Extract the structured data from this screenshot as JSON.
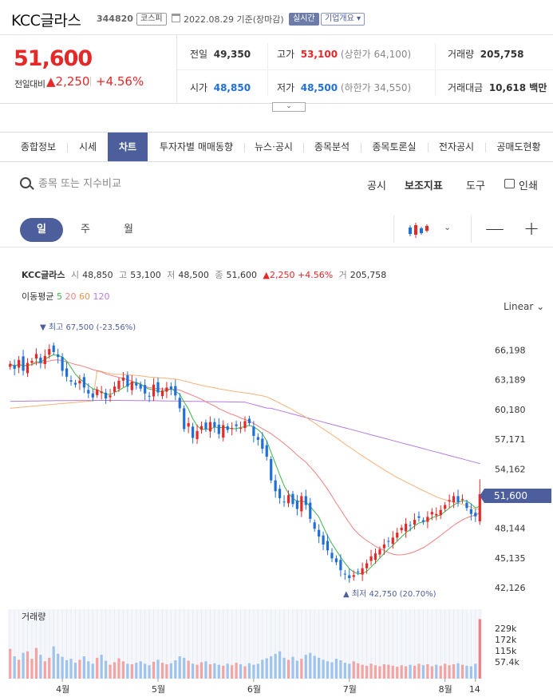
{
  "header": {
    "stock_name": "KCC글라스",
    "stock_code": "344820",
    "market_badge": "코스피",
    "date": "2022.08.29 기준(장마감)",
    "realtime_badge": "실시간",
    "company_badge": "기업개요 ▾"
  },
  "summary": {
    "current_price": "51,600",
    "change_label": "전일대비",
    "change_value": "▲2,250",
    "change_pct": "+4.56%",
    "prev_label": "전일",
    "prev_value": "49,350",
    "high_label": "고가",
    "high_value": "53,100",
    "upper_limit": "(상한가 64,100)",
    "volume_label": "거래량",
    "volume_value": "205,758",
    "open_label": "시가",
    "open_value": "48,850",
    "low_label": "저가",
    "low_value": "48,500",
    "lower_limit": "(하한가 34,550)",
    "amount_label": "거래대금",
    "amount_value": "10,618 백만",
    "toggle": "⌄"
  },
  "tabs": [
    {
      "label": "종합정보"
    },
    {
      "label": "시세"
    },
    {
      "label": "차트"
    },
    {
      "label": "투자자별 매매동향"
    },
    {
      "label": "뉴스·공시"
    },
    {
      "label": "종목분석"
    },
    {
      "label": "종목토론실"
    },
    {
      "label": "전자공시"
    },
    {
      "label": "공매도현황"
    }
  ],
  "toolbar": {
    "search_placeholder": "종목 또는 지수비교",
    "disclosure": "공시",
    "indicator": "보조지표",
    "tools": "도구",
    "print": "인쇄"
  },
  "period": {
    "day": "일",
    "week": "주",
    "month": "월",
    "zoom_out": "—",
    "zoom_in": "+"
  },
  "info": {
    "name": "KCC글라스",
    "open_l": "시",
    "open": "48,850",
    "high_l": "고",
    "high": "53,100",
    "low_l": "저",
    "low": "48,500",
    "close_l": "종",
    "close": "51,600",
    "chg": "▲2,250 +4.56%",
    "vol_l": "거",
    "vol": "205,758"
  },
  "ma": {
    "label": "이동평균",
    "ma5": "5",
    "ma20": "20",
    "ma60": "60",
    "ma120": "120"
  },
  "scale_mode": "Linear ⌄",
  "colors": {
    "up": "#e52828",
    "down": "#1f6fd6",
    "ma5": "#3cb44b",
    "ma20": "#f08080",
    "ma60": "#f5b27a",
    "ma120": "#b57be0",
    "accent": "#4c5f9c"
  },
  "chart_data": {
    "type": "candlestick",
    "y_ticks": [
      66198,
      63189,
      60180,
      57171,
      54162,
      48144,
      45135,
      42126
    ],
    "y_tick_labels": [
      "66,198",
      "63,189",
      "60,180",
      "57,171",
      "54,162",
      "48,144",
      "45,135",
      "42,126"
    ],
    "ylim": [
      41000,
      68500
    ],
    "x_tick_labels": [
      "4월",
      "5월",
      "6월",
      "7월",
      "8월",
      "14"
    ],
    "current_label": "51,600",
    "max_label": "▼ 최고 67,500 (-23.56%)",
    "min_label": "▲ 최저 42,750 (20.70%)",
    "closes": [
      64800,
      64300,
      65200,
      64100,
      64900,
      65100,
      65800,
      64900,
      65600,
      66300,
      66000,
      65500,
      64100,
      63500,
      63000,
      62700,
      63100,
      62400,
      61800,
      61400,
      62200,
      62000,
      61300,
      61600,
      62500,
      63100,
      63400,
      62500,
      63000,
      62600,
      62300,
      61800,
      61500,
      62700,
      61900,
      62100,
      62400,
      62200,
      61600,
      60300,
      58200,
      58800,
      57300,
      58000,
      58500,
      58200,
      58900,
      58400,
      57700,
      58600,
      58100,
      58300,
      58500,
      58300,
      59000,
      58800,
      57500,
      57100,
      56200,
      55400,
      53000,
      51900,
      51200,
      50800,
      51500,
      50600,
      50100,
      51400,
      50500,
      49100,
      48100,
      47300,
      46500,
      45900,
      45100,
      44700,
      43900,
      43500,
      43100,
      43400,
      43700,
      44100,
      44600,
      45300,
      45600,
      46000,
      46500,
      46800,
      47200,
      47700,
      48200,
      48600,
      48400,
      49000,
      49200,
      48800,
      49300,
      49800,
      49600,
      50000,
      50500,
      51000,
      51400,
      50800,
      51100,
      50200,
      49600,
      49350,
      51600
    ],
    "volume_ticks": [
      "229k",
      "172k",
      "115k",
      "57.4k"
    ],
    "volume_label": "거래량",
    "volumes": [
      60,
      45,
      38,
      52,
      55,
      40,
      62,
      48,
      35,
      42,
      65,
      50,
      44,
      37,
      40,
      32,
      38,
      45,
      35,
      30,
      42,
      48,
      36,
      28,
      33,
      41,
      35,
      30,
      29,
      32,
      35,
      30,
      27,
      34,
      38,
      32,
      29,
      31,
      37,
      45,
      42,
      36,
      30,
      28,
      33,
      35,
      29,
      31,
      28,
      26,
      30,
      27,
      32,
      29,
      25,
      31,
      28,
      30,
      38,
      41,
      45,
      50,
      55,
      42,
      38,
      44,
      36,
      40,
      48,
      52,
      46,
      42,
      38,
      35,
      33,
      40,
      37,
      32,
      30,
      35,
      31,
      28,
      26,
      30,
      27,
      25,
      29,
      28,
      26,
      24,
      27,
      25,
      28,
      26,
      30,
      27,
      29,
      25,
      28,
      26,
      30,
      27,
      29,
      31,
      28,
      26,
      25,
      30,
      120
    ]
  }
}
